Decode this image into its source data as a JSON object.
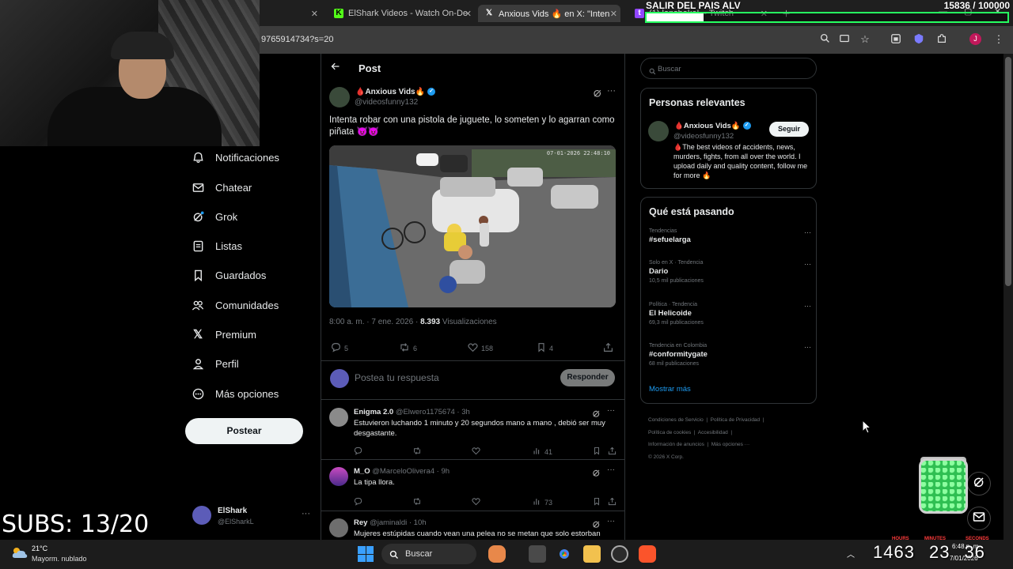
{
  "browser": {
    "tabs": [
      {
        "title": "ElShark Videos - Watch On-Der",
        "favicon": "kick-icon",
        "color": "#53fc18"
      },
      {
        "title": "Anxious Vids 🔥 en X: \"Inten",
        "favicon": "x-icon",
        "color": "#ffffff"
      },
      {
        "title": "(1) lanshakeL - Twitch",
        "favicon": "twitch-icon",
        "color": "#9146ff"
      }
    ],
    "url": "9765914734?s=20"
  },
  "overlay": {
    "goal_text": "SALIR DEL PAIS ALV",
    "goal_count": "15836 / 100000",
    "goal_progress": 0.158,
    "subs": "SUBS: 13/20",
    "timer": {
      "hours": "1463",
      "minutes": "23",
      "seconds": "36"
    },
    "timer_labels": {
      "hours": "HOURS",
      "minutes": "MINUTES",
      "seconds": "SECONDS"
    }
  },
  "nav": {
    "items": [
      {
        "label": "Notificaciones",
        "icon": "bell-icon"
      },
      {
        "label": "Chatear",
        "icon": "mail-icon"
      },
      {
        "label": "Grok",
        "icon": "grok-icon"
      },
      {
        "label": "Listas",
        "icon": "list-icon"
      },
      {
        "label": "Guardados",
        "icon": "bookmark-icon"
      },
      {
        "label": "Comunidades",
        "icon": "people-icon"
      },
      {
        "label": "Premium",
        "icon": "x-logo-icon"
      },
      {
        "label": "Perfil",
        "icon": "person-icon"
      },
      {
        "label": "Más opciones",
        "icon": "more-circle-icon"
      }
    ],
    "post_button": "Postear",
    "account": {
      "name": "ElShark",
      "handle": "@ElSharkL"
    }
  },
  "post": {
    "header": "Post",
    "author_name": "🩸Anxious Vids🔥",
    "author_handle": "@videosfunny132",
    "text": "Intenta robar con una pistola de juguete, lo someten y lo agarran como piñata 😈😈",
    "timestamp": "8:00 a. m. · 7 ene. 2026 · ",
    "views_count": "8.393",
    "views_label": " Visualizaciones",
    "stats": {
      "replies": "5",
      "reposts": "6",
      "likes": "158",
      "bookmarks": "4"
    },
    "reply_placeholder": "Postea tu respuesta",
    "reply_button": "Responder"
  },
  "replies": [
    {
      "name": "Enigma 2.0",
      "handle": "@Elwero1175674 · 3h",
      "text": "Estuvieron luchando 1 minuto y 20 segundos mano a mano ,  debió ser muy desgastante.",
      "views": "41",
      "avatar_color": "#8a8a8a"
    },
    {
      "name": "M_O",
      "handle": "@MarceloOlivera4 · 9h",
      "text": "La tipa llora.",
      "views": "73",
      "avatar_color": "#b04aa8"
    },
    {
      "name": "Rey",
      "handle": "@jaminaldi · 10h",
      "text": "Mujeres estúpidas cuando vean una pelea no se metan que solo estorban",
      "views": "",
      "avatar_color": "#6e6e6e"
    }
  ],
  "sidebar": {
    "search_placeholder": "Buscar",
    "relevant_title": "Personas relevantes",
    "relevant": {
      "name": "🩸Anxious Vids🔥",
      "handle": "@videosfunny132",
      "bio": "🩸The best videos of accidents, news, murders, fights, from all over the world. I upload daily and quality content, follow me for more 🔥",
      "follow": "Seguir"
    },
    "trends_title": "Qué está pasando",
    "trends": [
      {
        "context": "Tendencias",
        "name": "#sefuelarga",
        "count": ""
      },
      {
        "context": "Solo en X · Tendencia",
        "name": "Dario",
        "count": "10,5 mil publicaciones"
      },
      {
        "context": "Política · Tendencia",
        "name": "El Helicoide",
        "count": "69,3 mil publicaciones"
      },
      {
        "context": "Tendencia en Colombia",
        "name": "#conformitygate",
        "count": "68 mil publicaciones"
      }
    ],
    "show_more": "Mostrar más",
    "footer": [
      "Condiciones de Servicio",
      "Política de Privacidad",
      "Política de cookies",
      "Accesibilidad",
      "Información de anuncios",
      "Más opciones ···",
      "© 2026 X Corp."
    ]
  },
  "taskbar": {
    "temperature": "21°C",
    "weather": "Mayorm. nublado",
    "search_placeholder": "Buscar",
    "time": "6:48 p. m.",
    "date": "7/01/2026"
  }
}
